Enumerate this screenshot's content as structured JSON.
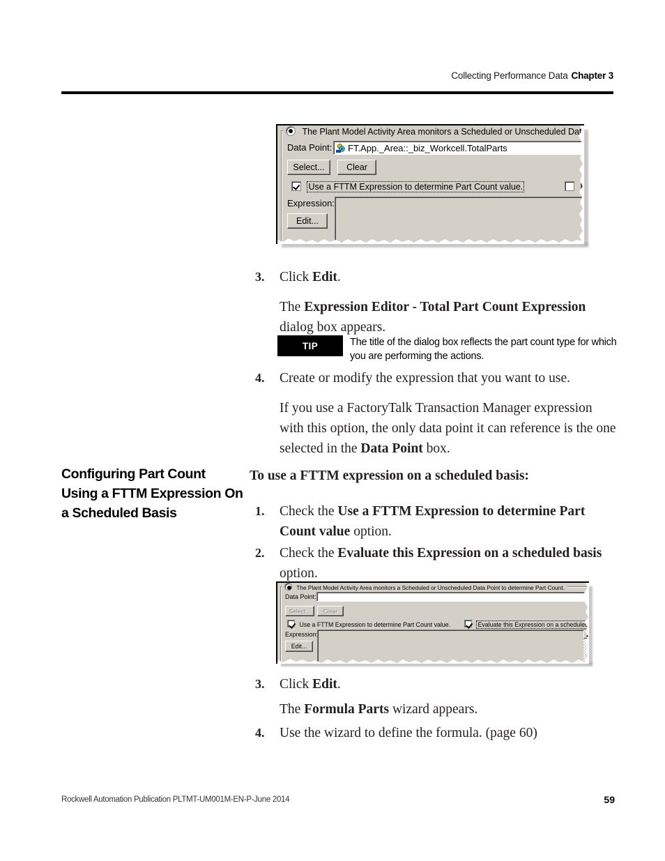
{
  "header": {
    "running_head": "Collecting Performance Data",
    "chapter": "Chapter 3"
  },
  "side_heading": "Configuring Part Count Using a FTTM Expression On a Scheduled Basis",
  "figure_one": {
    "name": "part-count-data-point-dialog",
    "group_label": "The Plant Model Activity Area monitors a Scheduled or Unscheduled Data P",
    "data_point_label": "Data Point:",
    "data_point_value": "FT.App._Area::_biz_Workcell.TotalParts",
    "data_point_icon": "tag-icon",
    "select_button": "Select...",
    "clear_button": "Clear",
    "use_expression_checkbox": "Use a FTTM Expression to determine Part Count value.",
    "use_expression_checked": true,
    "evaluate_checkbox_partial": "E",
    "evaluate_checked": false,
    "expression_label": "Expression:",
    "edit_button": "Edit...",
    "expression_value": ""
  },
  "figure_two": {
    "name": "scheduled-basis-data-point-dialog",
    "group_label": "The Plant Model Activity Area monitors a Scheduled or Unscheduled Data Point to determine Part Count.",
    "data_point_label": "Data Point:",
    "data_point_value": "",
    "select_button": "Select...",
    "select_disabled": true,
    "clear_button": "Clear",
    "clear_disabled": true,
    "use_expression_checkbox": "Use a FTTM Expression to determine Part Count value.",
    "use_expression_checked": true,
    "evaluate_checkbox": "Evaluate this Expression on a scheduled basis",
    "evaluate_checked": true,
    "expression_label": "Expression:",
    "edit_button": "Edit...",
    "expression_value": ""
  },
  "steps_upper": {
    "step3_num": "3.",
    "step3_pre": "Click ",
    "step3_bold": "Edit",
    "step3_post": ".",
    "result3_pre": "The ",
    "result3_bold": "Expression Editor - Total Part Count Expression",
    "result3_post": " dialog box appears.",
    "step4_num": "4.",
    "step4_text": "Create or modify the expression that you want to use.",
    "note4_pre": "If you use a FactoryTalk Transaction Manager expression with this option, the only data point it can reference is the one selected in the ",
    "note4_bold": "Data Point",
    "note4_post": " box."
  },
  "tip": {
    "badge": "TIP",
    "text": "The title of the dialog box reflects the part count type for which you are performing the actions."
  },
  "steps_lower": {
    "intro": "To use a FTTM expression on a scheduled basis:",
    "step1_num": "1.",
    "step1_pre": "Check the ",
    "step1_bold": "Use a FTTM Expression to determine Part Count value",
    "step1_post": " option.",
    "step2_num": "2.",
    "step2_pre": "Check the ",
    "step2_bold": "Evaluate this Expression on a scheduled basis",
    "step2_post": " option.",
    "step3_num": "3.",
    "step3_pre": "Click ",
    "step3_bold": "Edit",
    "step3_post": ".",
    "result3_pre": "The ",
    "result3_bold": "Formula Parts",
    "result3_post": " wizard appears.",
    "step4_num": "4.",
    "step4_text": "Use the wizard to define the formula. (page 60)"
  },
  "footer": {
    "publication": "Rockwell Automation Publication PLTMT-UM001M-EN-P-June 2014",
    "page_number": "59"
  },
  "colors": {
    "dialog_face": "#d4d0c8",
    "field_white": "#ffffff",
    "tip_badge_bg": "#000000",
    "rule": "#000000"
  }
}
